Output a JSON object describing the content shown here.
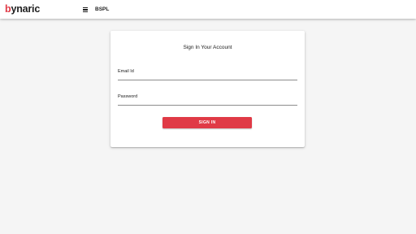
{
  "header": {
    "logo_first_letter": "b",
    "logo_rest": "ynaric",
    "menu_icon": "hamburger-menu-icon",
    "company_code": "BSPL"
  },
  "login": {
    "title": "Sign In Your Account",
    "email_label": "Email Id",
    "email_value": "",
    "password_label": "Password",
    "password_value": "",
    "submit_label": "SIGN IN"
  },
  "colors": {
    "accent": "#e03a46",
    "background": "#f5f5f5",
    "card": "#ffffff",
    "text": "#212121"
  }
}
